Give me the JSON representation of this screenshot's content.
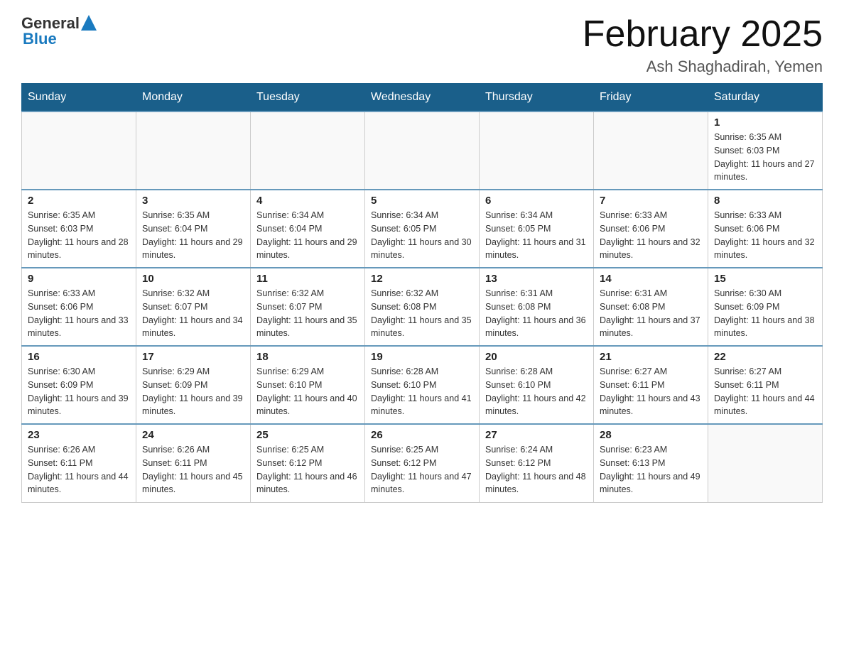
{
  "header": {
    "logo_general": "General",
    "logo_blue": "Blue",
    "title": "February 2025",
    "subtitle": "Ash Shaghadirah, Yemen"
  },
  "weekdays": [
    "Sunday",
    "Monday",
    "Tuesday",
    "Wednesday",
    "Thursday",
    "Friday",
    "Saturday"
  ],
  "weeks": [
    [
      {
        "day": "",
        "sunrise": "",
        "sunset": "",
        "daylight": ""
      },
      {
        "day": "",
        "sunrise": "",
        "sunset": "",
        "daylight": ""
      },
      {
        "day": "",
        "sunrise": "",
        "sunset": "",
        "daylight": ""
      },
      {
        "day": "",
        "sunrise": "",
        "sunset": "",
        "daylight": ""
      },
      {
        "day": "",
        "sunrise": "",
        "sunset": "",
        "daylight": ""
      },
      {
        "day": "",
        "sunrise": "",
        "sunset": "",
        "daylight": ""
      },
      {
        "day": "1",
        "sunrise": "Sunrise: 6:35 AM",
        "sunset": "Sunset: 6:03 PM",
        "daylight": "Daylight: 11 hours and 27 minutes."
      }
    ],
    [
      {
        "day": "2",
        "sunrise": "Sunrise: 6:35 AM",
        "sunset": "Sunset: 6:03 PM",
        "daylight": "Daylight: 11 hours and 28 minutes."
      },
      {
        "day": "3",
        "sunrise": "Sunrise: 6:35 AM",
        "sunset": "Sunset: 6:04 PM",
        "daylight": "Daylight: 11 hours and 29 minutes."
      },
      {
        "day": "4",
        "sunrise": "Sunrise: 6:34 AM",
        "sunset": "Sunset: 6:04 PM",
        "daylight": "Daylight: 11 hours and 29 minutes."
      },
      {
        "day": "5",
        "sunrise": "Sunrise: 6:34 AM",
        "sunset": "Sunset: 6:05 PM",
        "daylight": "Daylight: 11 hours and 30 minutes."
      },
      {
        "day": "6",
        "sunrise": "Sunrise: 6:34 AM",
        "sunset": "Sunset: 6:05 PM",
        "daylight": "Daylight: 11 hours and 31 minutes."
      },
      {
        "day": "7",
        "sunrise": "Sunrise: 6:33 AM",
        "sunset": "Sunset: 6:06 PM",
        "daylight": "Daylight: 11 hours and 32 minutes."
      },
      {
        "day": "8",
        "sunrise": "Sunrise: 6:33 AM",
        "sunset": "Sunset: 6:06 PM",
        "daylight": "Daylight: 11 hours and 32 minutes."
      }
    ],
    [
      {
        "day": "9",
        "sunrise": "Sunrise: 6:33 AM",
        "sunset": "Sunset: 6:06 PM",
        "daylight": "Daylight: 11 hours and 33 minutes."
      },
      {
        "day": "10",
        "sunrise": "Sunrise: 6:32 AM",
        "sunset": "Sunset: 6:07 PM",
        "daylight": "Daylight: 11 hours and 34 minutes."
      },
      {
        "day": "11",
        "sunrise": "Sunrise: 6:32 AM",
        "sunset": "Sunset: 6:07 PM",
        "daylight": "Daylight: 11 hours and 35 minutes."
      },
      {
        "day": "12",
        "sunrise": "Sunrise: 6:32 AM",
        "sunset": "Sunset: 6:08 PM",
        "daylight": "Daylight: 11 hours and 35 minutes."
      },
      {
        "day": "13",
        "sunrise": "Sunrise: 6:31 AM",
        "sunset": "Sunset: 6:08 PM",
        "daylight": "Daylight: 11 hours and 36 minutes."
      },
      {
        "day": "14",
        "sunrise": "Sunrise: 6:31 AM",
        "sunset": "Sunset: 6:08 PM",
        "daylight": "Daylight: 11 hours and 37 minutes."
      },
      {
        "day": "15",
        "sunrise": "Sunrise: 6:30 AM",
        "sunset": "Sunset: 6:09 PM",
        "daylight": "Daylight: 11 hours and 38 minutes."
      }
    ],
    [
      {
        "day": "16",
        "sunrise": "Sunrise: 6:30 AM",
        "sunset": "Sunset: 6:09 PM",
        "daylight": "Daylight: 11 hours and 39 minutes."
      },
      {
        "day": "17",
        "sunrise": "Sunrise: 6:29 AM",
        "sunset": "Sunset: 6:09 PM",
        "daylight": "Daylight: 11 hours and 39 minutes."
      },
      {
        "day": "18",
        "sunrise": "Sunrise: 6:29 AM",
        "sunset": "Sunset: 6:10 PM",
        "daylight": "Daylight: 11 hours and 40 minutes."
      },
      {
        "day": "19",
        "sunrise": "Sunrise: 6:28 AM",
        "sunset": "Sunset: 6:10 PM",
        "daylight": "Daylight: 11 hours and 41 minutes."
      },
      {
        "day": "20",
        "sunrise": "Sunrise: 6:28 AM",
        "sunset": "Sunset: 6:10 PM",
        "daylight": "Daylight: 11 hours and 42 minutes."
      },
      {
        "day": "21",
        "sunrise": "Sunrise: 6:27 AM",
        "sunset": "Sunset: 6:11 PM",
        "daylight": "Daylight: 11 hours and 43 minutes."
      },
      {
        "day": "22",
        "sunrise": "Sunrise: 6:27 AM",
        "sunset": "Sunset: 6:11 PM",
        "daylight": "Daylight: 11 hours and 44 minutes."
      }
    ],
    [
      {
        "day": "23",
        "sunrise": "Sunrise: 6:26 AM",
        "sunset": "Sunset: 6:11 PM",
        "daylight": "Daylight: 11 hours and 44 minutes."
      },
      {
        "day": "24",
        "sunrise": "Sunrise: 6:26 AM",
        "sunset": "Sunset: 6:11 PM",
        "daylight": "Daylight: 11 hours and 45 minutes."
      },
      {
        "day": "25",
        "sunrise": "Sunrise: 6:25 AM",
        "sunset": "Sunset: 6:12 PM",
        "daylight": "Daylight: 11 hours and 46 minutes."
      },
      {
        "day": "26",
        "sunrise": "Sunrise: 6:25 AM",
        "sunset": "Sunset: 6:12 PM",
        "daylight": "Daylight: 11 hours and 47 minutes."
      },
      {
        "day": "27",
        "sunrise": "Sunrise: 6:24 AM",
        "sunset": "Sunset: 6:12 PM",
        "daylight": "Daylight: 11 hours and 48 minutes."
      },
      {
        "day": "28",
        "sunrise": "Sunrise: 6:23 AM",
        "sunset": "Sunset: 6:13 PM",
        "daylight": "Daylight: 11 hours and 49 minutes."
      },
      {
        "day": "",
        "sunrise": "",
        "sunset": "",
        "daylight": ""
      }
    ]
  ]
}
